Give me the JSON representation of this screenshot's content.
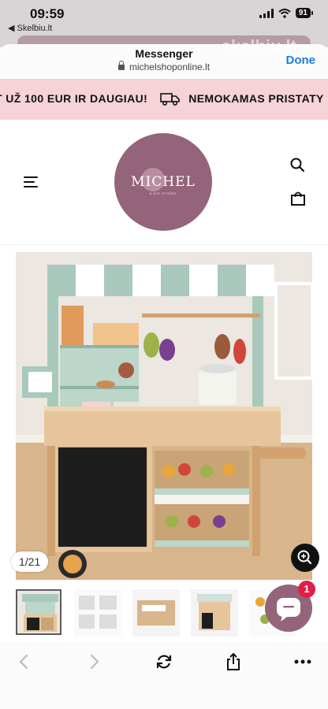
{
  "status_bar": {
    "time": "09:59",
    "back_label": "◀ Skelbiu.lt",
    "battery": "91"
  },
  "browser": {
    "title": "Messenger",
    "url": "michelshoponline.lt",
    "done_label": "Done",
    "watermark": "skelbiu.lt"
  },
  "announcement": {
    "left_text": "T UŽ 100 EUR IR DAUGIAU!",
    "right_text": "NEMOKAMAS PRISTATY"
  },
  "header": {
    "logo_text": "MICHEL",
    "logo_sub": "KIDS STORE"
  },
  "gallery": {
    "counter": "1/21",
    "thumbnails": [
      {
        "label": "kitchen-front"
      },
      {
        "label": "instructions"
      },
      {
        "label": "box"
      },
      {
        "label": "kitchen-side"
      },
      {
        "label": "accessories"
      }
    ]
  },
  "chat": {
    "badge": "1"
  },
  "colors": {
    "announcement_bg": "#f5d3d8",
    "brand": "#94647a",
    "link_blue": "#1a7de0",
    "badge_red": "#e11d48"
  },
  "icons": [
    "menu-icon",
    "search-icon",
    "bag-icon",
    "zoom-icon",
    "chat-icon",
    "back-icon",
    "forward-icon",
    "reload-icon",
    "share-icon",
    "more-icon",
    "truck-icon",
    "lock-icon"
  ]
}
